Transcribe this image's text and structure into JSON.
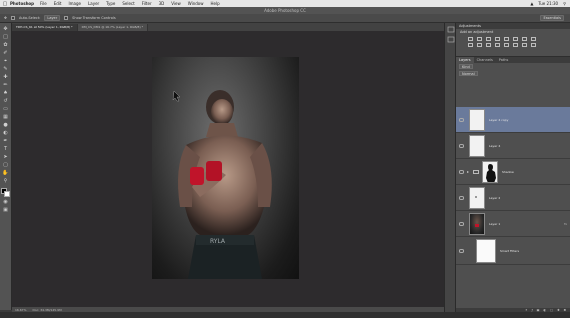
{
  "menubar": {
    "app_name": "Photoshop",
    "items": [
      "File",
      "Edit",
      "Image",
      "Layer",
      "Type",
      "Select",
      "Filter",
      "3D",
      "View",
      "Window",
      "Help"
    ],
    "clock": "Tue 21:30"
  },
  "titlebar": {
    "title": "Adobe Photoshop CC"
  },
  "optionsbar": {
    "auto_select_label": "Auto-Select:",
    "auto_select_value": "Layer",
    "transform_label": "Show Transform Controls",
    "workspace": "Essentials"
  },
  "document_tabs": [
    {
      "label": "TDH-CS_61 at 50% (Layer 1, RGB/8) *"
    },
    {
      "label": "DM_CS_DM1 @ 16.7% (Layer 1, RGB/8) *"
    }
  ],
  "tools": [
    "move-tool",
    "marquee-tool",
    "lasso-tool",
    "quick-select-tool",
    "crop-tool",
    "eyedropper-tool",
    "healing-tool",
    "brush-tool",
    "clone-stamp-tool",
    "history-brush-tool",
    "eraser-tool",
    "gradient-tool",
    "blur-tool",
    "dodge-tool",
    "pen-tool",
    "type-tool",
    "path-select-tool",
    "shape-tool",
    "hand-tool",
    "zoom-tool"
  ],
  "statusbar": {
    "zoom": "16.67%",
    "doc_info": "Doc: 34.3M/145.9M"
  },
  "adjustments": {
    "tab": "Adjustments",
    "subtitle": "Add an adjustment"
  },
  "layers": {
    "tabs": [
      "Layers",
      "Channels",
      "Paths"
    ],
    "filter_value": "Kind",
    "blend_mode": "Normal",
    "items": [
      {
        "name": "Layer 4 copy",
        "selected": true,
        "visible": true,
        "thumb": "white"
      },
      {
        "name": "Layer 4",
        "selected": false,
        "visible": true,
        "thumb": "white"
      },
      {
        "name": "Shadow",
        "selected": false,
        "visible": true,
        "thumb": "silhouette",
        "group": true
      },
      {
        "name": "Layer 2",
        "selected": false,
        "visible": true,
        "thumb": "white-dot"
      },
      {
        "name": "Layer 1",
        "selected": false,
        "visible": true,
        "thumb": "photo",
        "fx": "fx"
      },
      {
        "name": "Smart Filters",
        "selected": false,
        "visible": true,
        "thumb": "white-small"
      }
    ]
  },
  "colors": {
    "selected_layer": "#6a7a9b",
    "canvas_bg": "#2d2b2d",
    "panel_bg": "#4f4f4f",
    "gloves": "#c0142a"
  }
}
